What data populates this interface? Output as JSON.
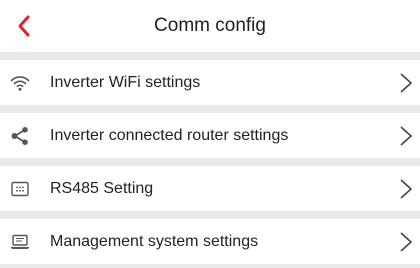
{
  "header": {
    "title": "Comm config",
    "back_icon": "chevron-left-icon"
  },
  "colors": {
    "accent": "#e0242a",
    "background": "#e9e9e9",
    "surface": "#ffffff",
    "text": "#222222"
  },
  "menu": {
    "items": [
      {
        "label": "Inverter WiFi settings",
        "icon": "wifi-icon"
      },
      {
        "label": "Inverter connected router settings",
        "icon": "share-icon"
      },
      {
        "label": "RS485 Setting",
        "icon": "rs485-port-icon"
      },
      {
        "label": "Management system settings",
        "icon": "laptop-icon"
      }
    ]
  }
}
